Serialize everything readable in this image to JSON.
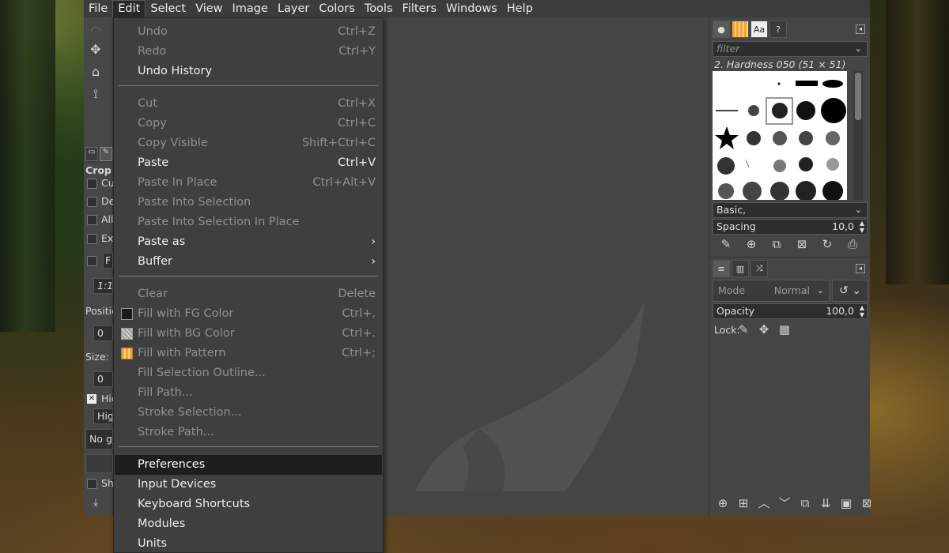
{
  "menubar": {
    "items": [
      "File",
      "Edit",
      "Select",
      "View",
      "Image",
      "Layer",
      "Colors",
      "Tools",
      "Filters",
      "Windows",
      "Help"
    ],
    "active": "Edit"
  },
  "edit_menu": {
    "items": [
      {
        "label": "Undo",
        "accel": "Ctrl+Z",
        "state": "disabled"
      },
      {
        "label": "Redo",
        "accel": "Ctrl+Y",
        "state": "disabled"
      },
      {
        "label": "Undo History",
        "accel": "",
        "state": "enabled"
      },
      {
        "label": "Cut",
        "accel": "Ctrl+X",
        "state": "disabled"
      },
      {
        "label": "Copy",
        "accel": "Ctrl+C",
        "state": "disabled"
      },
      {
        "label": "Copy Visible",
        "accel": "Shift+Ctrl+C",
        "state": "disabled"
      },
      {
        "label": "Paste",
        "accel": "Ctrl+V",
        "state": "enabled"
      },
      {
        "label": "Paste In Place",
        "accel": "Ctrl+Alt+V",
        "state": "disabled"
      },
      {
        "label": "Paste Into Selection",
        "accel": "",
        "state": "disabled"
      },
      {
        "label": "Paste Into Selection In Place",
        "accel": "",
        "state": "disabled"
      },
      {
        "label": "Paste as",
        "accel": "",
        "state": "enabled",
        "submenu": true
      },
      {
        "label": "Buffer",
        "accel": "",
        "state": "enabled",
        "submenu": true
      },
      {
        "label": "Clear",
        "accel": "Delete",
        "state": "disabled"
      },
      {
        "label": "Fill with FG Color",
        "accel": "Ctrl+,",
        "state": "disabled",
        "swatch": "fg"
      },
      {
        "label": "Fill with BG Color",
        "accel": "Ctrl+.",
        "state": "disabled",
        "swatch": "bg"
      },
      {
        "label": "Fill with Pattern",
        "accel": "Ctrl+;",
        "state": "disabled",
        "swatch": "pattern"
      },
      {
        "label": "Fill Selection Outline...",
        "accel": "",
        "state": "disabled"
      },
      {
        "label": "Fill Path...",
        "accel": "",
        "state": "disabled"
      },
      {
        "label": "Stroke Selection...",
        "accel": "",
        "state": "disabled"
      },
      {
        "label": "Stroke Path...",
        "accel": "",
        "state": "disabled"
      },
      {
        "label": "Preferences",
        "accel": "",
        "state": "hover"
      },
      {
        "label": "Input Devices",
        "accel": "",
        "state": "enabled"
      },
      {
        "label": "Keyboard Shortcuts",
        "accel": "",
        "state": "enabled"
      },
      {
        "label": "Modules",
        "accel": "",
        "state": "enabled"
      },
      {
        "label": "Units",
        "accel": "",
        "state": "enabled"
      }
    ]
  },
  "tool_options": {
    "title": "Crop",
    "labels": [
      "Cu",
      "De",
      "All",
      "Ex",
      "F",
      "1:1",
      "Positio",
      "0",
      "Size:",
      "0",
      "Hig",
      "Hig",
      "No g",
      "Sh"
    ]
  },
  "brushes": {
    "filter_placeholder": "filter",
    "current_brush": "2. Hardness 050 (51 × 51)",
    "tag_select": "Basic,",
    "spacing_label": "Spacing",
    "spacing_value": "10,0"
  },
  "layers": {
    "mode_label": "Mode",
    "mode_value": "Normal",
    "opacity_label": "Opacity",
    "opacity_value": "100,0",
    "lock_label": "Lock:"
  },
  "colors": {
    "menu_bg": "#3f3f3f",
    "menu_hover": "#1e1e1e",
    "panel_bg": "#454545",
    "disabled_text": "#8f8f8f"
  }
}
